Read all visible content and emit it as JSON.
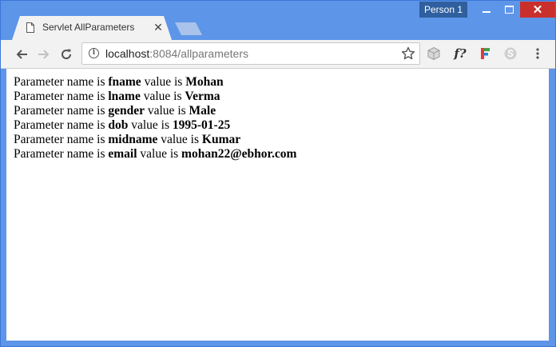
{
  "window": {
    "profile_label": "Person 1"
  },
  "tabs": [
    {
      "title": "Servlet AllParameters",
      "active": true
    }
  ],
  "toolbar": {
    "url_host": "localhost",
    "url_rest": ":8084/allparameters"
  },
  "extensions": [
    "cube-icon",
    "f-icon",
    "color-icon",
    "skype-icon"
  ],
  "content": {
    "prefix": "Parameter name is",
    "mid": "value is",
    "params": [
      {
        "name": "fname",
        "value": "Mohan"
      },
      {
        "name": "lname",
        "value": "Verma"
      },
      {
        "name": "gender",
        "value": "Male"
      },
      {
        "name": "dob",
        "value": "1995-01-25"
      },
      {
        "name": "midname",
        "value": "Kumar"
      },
      {
        "name": "email",
        "value": "mohan22@ebhor.com"
      }
    ]
  },
  "colors": {
    "frame": "#5d95e8",
    "close_button": "#c9302c",
    "profile_badge": "#2f5f9e"
  }
}
